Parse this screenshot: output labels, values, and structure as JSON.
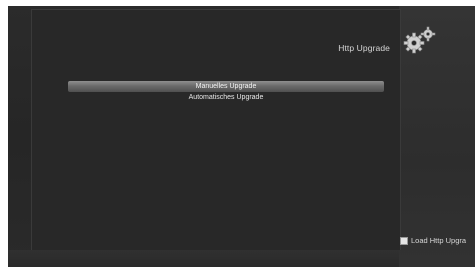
{
  "screen": {
    "title": "Http Upgrade"
  },
  "menu": {
    "items": [
      {
        "label": "Manuelles Upgrade",
        "selected": true
      },
      {
        "label": "Automatisches Upgrade",
        "selected": false
      }
    ]
  },
  "footer": {
    "legend_label": "Load Http Upgra"
  },
  "icons": {
    "header_icon": "gear-icon",
    "legend_icon": "white-square-icon"
  },
  "colors": {
    "background": "#282828",
    "highlight": "#7a7a7a",
    "text": "#e8e8e8"
  }
}
